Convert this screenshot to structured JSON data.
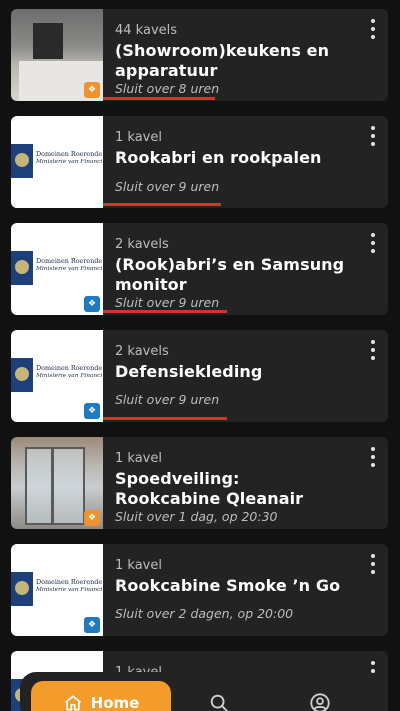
{
  "listings": [
    {
      "lots": "44 kavels",
      "title": "(Showroom)keukens en apparatuur",
      "closes": "Sluit over 8 uren",
      "thumb": "kitchen-photo",
      "badge_color": "#f0922d"
    },
    {
      "lots": "1 kavel",
      "title": "Rookabri en rookpalen",
      "closes": "Sluit over 9 uren",
      "thumb": "government-logo",
      "badge_color": ""
    },
    {
      "lots": "2 kavels",
      "title": "(Rook)abri’s en Samsung monitor",
      "closes": "Sluit over 9 uren",
      "thumb": "government-logo",
      "badge_color": "#1f7ac0"
    },
    {
      "lots": "2 kavels",
      "title": "Defensiekleding",
      "closes": "Sluit over 9 uren",
      "thumb": "government-logo",
      "badge_color": "#1f7ac0"
    },
    {
      "lots": "1 kavel",
      "title": "Spoedveiling: Rookcabine Qleanair",
      "closes": "Sluit over 1 dag, op 20:30",
      "thumb": "cabin-photo",
      "badge_color": "#f0922d"
    },
    {
      "lots": "1 kavel",
      "title": "Rookcabine Smoke ’n Go",
      "closes": "Sluit over 2 dagen, op 20:00",
      "thumb": "government-logo",
      "badge_color": "#1f7ac0"
    },
    {
      "lots": "1 kavel",
      "title": "",
      "closes": "",
      "thumb": "government-logo",
      "badge_color": ""
    }
  ],
  "gov_logo": {
    "line1": "Domeinen Roerende Zaken",
    "line2": "Ministerie van Financiën"
  },
  "nav": {
    "home_label": "Home",
    "home_icon": "house-icon",
    "search_icon": "search-icon",
    "profile_icon": "user-icon"
  },
  "colors": {
    "accent": "#f39c2b",
    "closing_soon": "#d8322b",
    "card_bg": "#232323",
    "page_bg": "#111111"
  }
}
